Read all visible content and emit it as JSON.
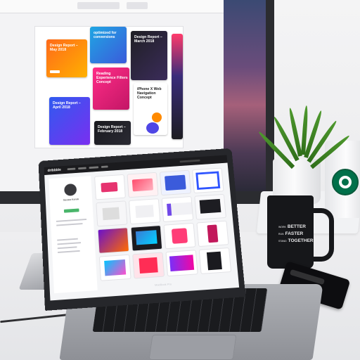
{
  "scene": {
    "colors": {
      "desk": "#ececee",
      "monitor_bezel": "#2b2c30",
      "laptop_body": "#9a9ca2",
      "mug": "#16171a",
      "plant": "#3f8a24",
      "starbucks_green": "#00704a"
    }
  },
  "monitor": {
    "cards": [
      {
        "title": "Design Report – May 2018",
        "colors": [
          "#ff6a1a",
          "#ffb100"
        ]
      },
      {
        "title": "optimized for conversions",
        "colors": [
          "#1fa6e3",
          "#3b5bdb"
        ]
      },
      {
        "title": "Design Report – March 2018",
        "colors": [
          "#1f1f24",
          "#3b2c5a"
        ]
      },
      {
        "title": "Reading Experience Filters Concept",
        "colors": [
          "#ff2d87",
          "#c31666"
        ]
      },
      {
        "title": "iPhone X Web Navigation Concept",
        "colors": [
          "#ffffff",
          "#f1f1f3"
        ]
      },
      {
        "title": "Design Report – April 2018",
        "colors": [
          "#2f5bf0",
          "#7a2ff0"
        ]
      },
      {
        "title": "Design Report – February 2018",
        "colors": [
          "#1a1a1f",
          "#2a2a33"
        ]
      }
    ]
  },
  "laptop": {
    "site_logo": "dribbble",
    "profile_name": "Seosa Koruk",
    "brand": "MacBook Pro"
  },
  "mug": {
    "lines": [
      {
        "small": "WORK",
        "big": "BETTER"
      },
      {
        "small": "RUN",
        "big": "FASTER"
      },
      {
        "small": "STAND",
        "big": "TOGETHER"
      }
    ]
  }
}
